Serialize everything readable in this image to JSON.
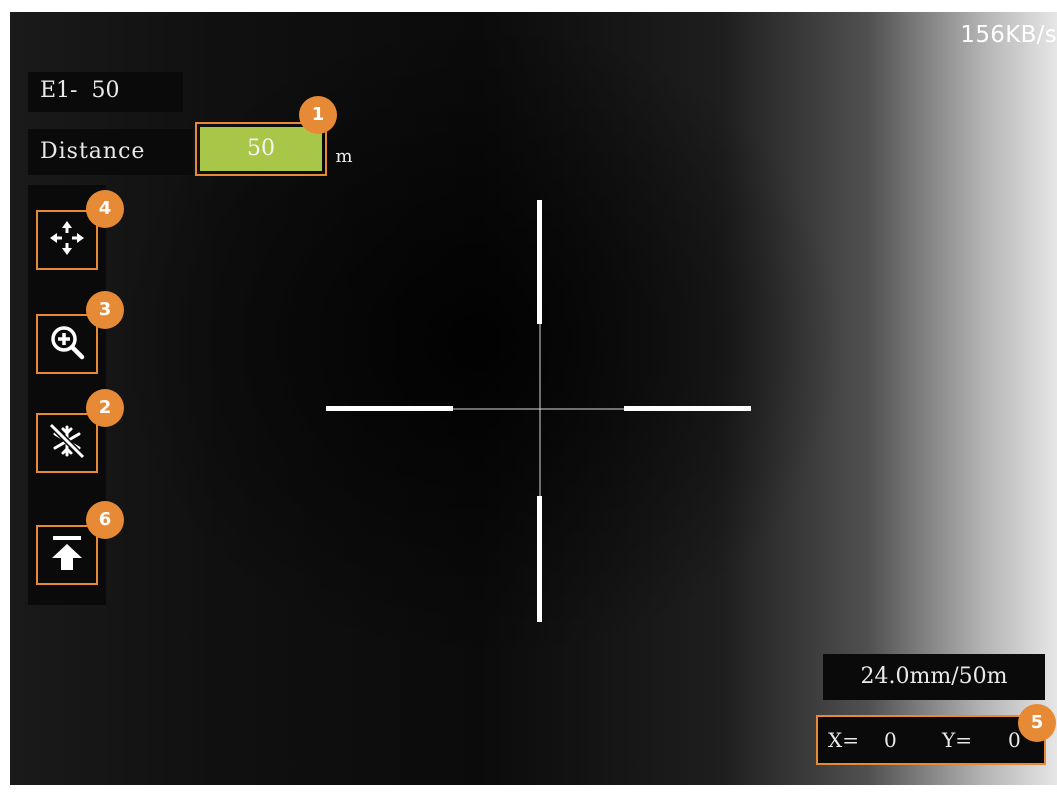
{
  "status": {
    "transfer_rate": "156KB/s"
  },
  "overlay": {
    "e1_label": "E1-",
    "e1_value": "50",
    "distance_label": "Distance",
    "distance_value": "50",
    "distance_unit": "m",
    "focal_info": "24.0mm/50m",
    "x_label": "X=",
    "x_value": "0",
    "y_label": "Y=",
    "y_value": "0"
  },
  "tools": [
    {
      "icon": "move-arrows-icon",
      "badge": "4"
    },
    {
      "icon": "zoom-in-icon",
      "badge": "3"
    },
    {
      "icon": "freeze-snowflake-icon",
      "badge": "2"
    },
    {
      "icon": "upload-arrow-icon",
      "badge": "6"
    }
  ],
  "badges": {
    "distance_field": "1",
    "coordinates": "5"
  },
  "colors": {
    "callout_orange": "#e78a36",
    "distance_field_green": "#a8c648",
    "reticle": "#ffffff",
    "panel_black": "#0a0a0a"
  }
}
